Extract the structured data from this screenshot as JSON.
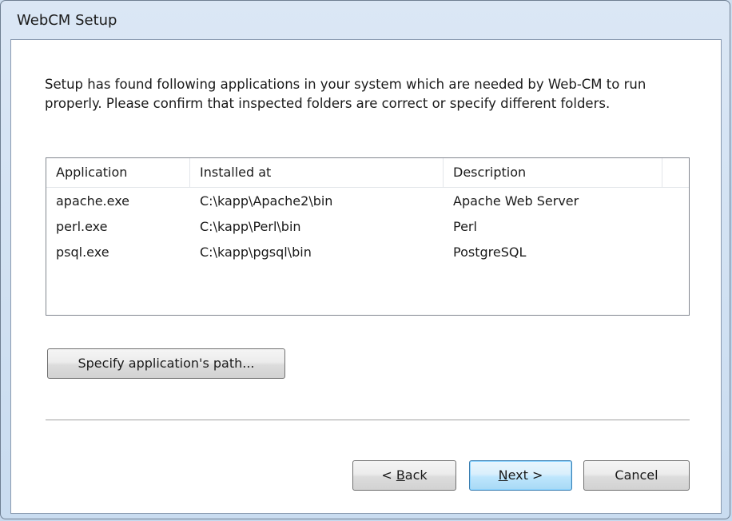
{
  "window": {
    "title": "WebCM Setup"
  },
  "instructions": "Setup has found following applications in your system which are needed by Web-CM to run properly. Please confirm that inspected folders are correct or specify different folders.",
  "table": {
    "headers": [
      "Application",
      "Installed at",
      "Description"
    ],
    "rows": [
      [
        "apache.exe",
        "C:\\kapp\\Apache2\\bin",
        "Apache Web Server"
      ],
      [
        "perl.exe",
        "C:\\kapp\\Perl\\bin",
        "Perl"
      ],
      [
        "psql.exe",
        "C:\\kapp\\pgsql\\bin",
        "PostgreSQL"
      ]
    ]
  },
  "buttons": {
    "specify_path": "Specify application's path...",
    "back_prefix": "< ",
    "back_mnemonic": "B",
    "back_suffix": "ack",
    "next_mnemonic": "N",
    "next_suffix": "ext >",
    "cancel": "Cancel"
  },
  "colors": {
    "default_button_border": "#3c7fb1",
    "window_frame": "#c9dcf0"
  }
}
